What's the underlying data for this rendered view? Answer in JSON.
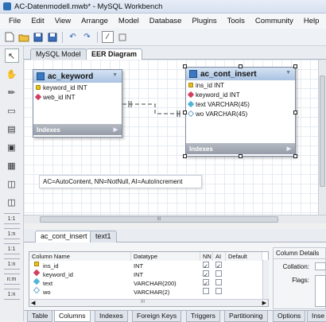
{
  "window": {
    "title": "AC-Datenmodell.mwb* - MySQL Workbench"
  },
  "menu": [
    "File",
    "Edit",
    "View",
    "Arrange",
    "Model",
    "Database",
    "Plugins",
    "Tools",
    "Community",
    "Help"
  ],
  "doc_tabs": [
    "MySQL Model",
    "EER Diagram"
  ],
  "left_tool_labels": {
    "rel_1_1": "1:1",
    "rel_1_n": "1:n",
    "rel_1_1b": "1:1",
    "rel_1_nb": "1:n",
    "rel_n_m": "n:m",
    "rel_1_n_c": "1:n"
  },
  "tables": {
    "ac_keyword": {
      "name": "ac_keyword",
      "columns": [
        {
          "icon": "primary-key",
          "text": "keyword_id INT"
        },
        {
          "icon": "foreign-key",
          "text": "web_id INT"
        }
      ],
      "footer": "Indexes"
    },
    "ac_cont_insert": {
      "name": "ac_cont_insert",
      "columns": [
        {
          "icon": "primary-key",
          "text": "ins_id INT"
        },
        {
          "icon": "foreign-key",
          "text": "keyword_id INT"
        },
        {
          "icon": "not-null",
          "text": "text VARCHAR(45)"
        },
        {
          "icon": "nullable",
          "text": "wo VARCHAR(45)"
        }
      ],
      "footer": "Indexes"
    }
  },
  "note": "AC=AutoContent,  NN=NotNull,  AI=AutoIncrement",
  "hscroll_label": "III",
  "bottom_tabs": [
    "ac_cont_insert",
    "text1"
  ],
  "grid": {
    "headers": [
      "Column Name",
      "Datatype",
      "NN",
      "AI",
      "Default"
    ],
    "rows": [
      {
        "icon": "primary-key",
        "name": "ins_id",
        "type": "INT",
        "nn": true,
        "ai": true
      },
      {
        "icon": "foreign-key",
        "name": "keyword_id",
        "type": "INT",
        "nn": true,
        "ai": false
      },
      {
        "icon": "not-null",
        "name": "text",
        "type": "VARCHAR(200)",
        "nn": true,
        "ai": false
      },
      {
        "icon": "nullable",
        "name": "wo",
        "type": "VARCHAR(2)",
        "nn": false,
        "ai": false
      }
    ],
    "scroll_label": "III"
  },
  "details": {
    "title": "Column Details",
    "collation_label": "Collation:",
    "flags_label": "Flags:"
  },
  "footer_tabs": [
    "Table",
    "Columns",
    "Indexes",
    "Foreign Keys",
    "Triggers",
    "Partitioning",
    "Options",
    "Inse"
  ]
}
